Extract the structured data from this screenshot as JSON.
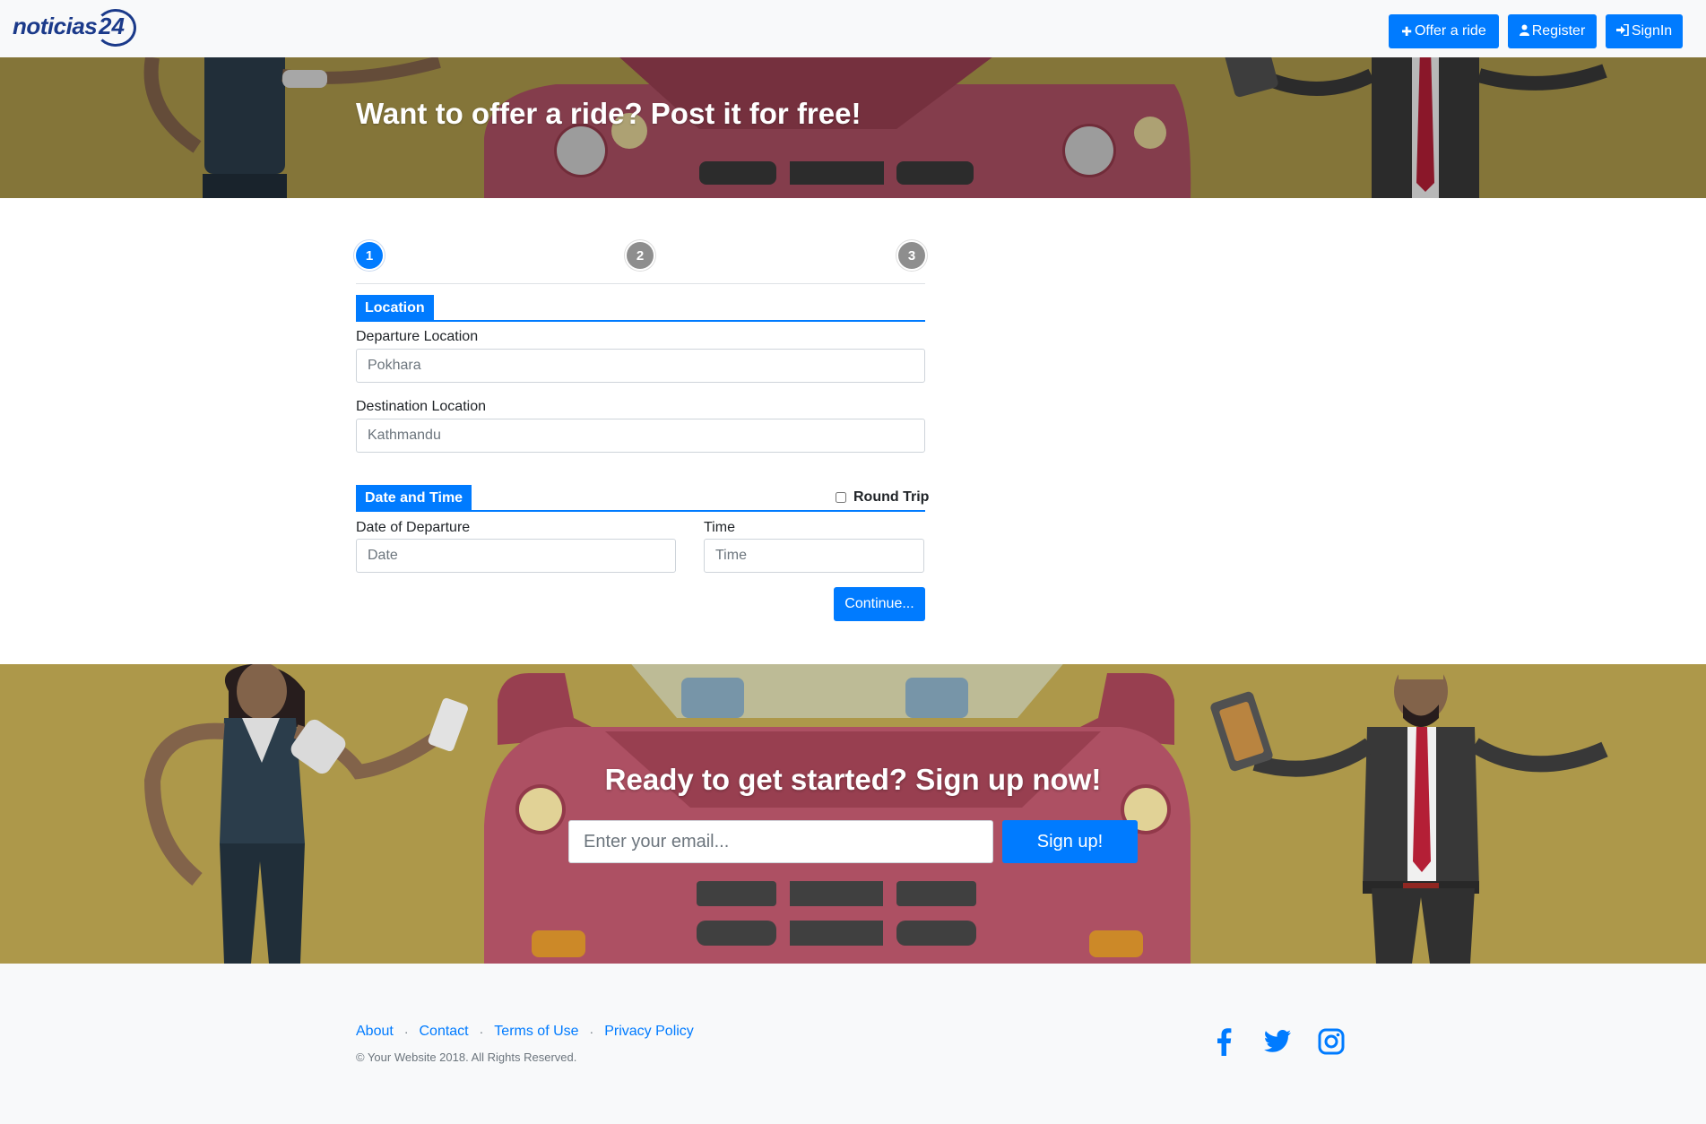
{
  "brand": {
    "logo_text": "noticias",
    "logo_number": "24"
  },
  "nav": {
    "offer_ride": "Offer a ride",
    "register": "Register",
    "signin": "SignIn"
  },
  "hero": {
    "title": "Want to offer a ride? Post it for free!"
  },
  "wizard": {
    "steps": [
      "1",
      "2",
      "3"
    ],
    "active_step": 1,
    "location_section": "Location",
    "departure_label": "Departure Location",
    "departure_placeholder": "Pokhara",
    "destination_label": "Destination Location",
    "destination_placeholder": "Kathmandu",
    "datetime_section": "Date and Time",
    "round_trip_label": "Round Trip",
    "date_label": "Date of Departure",
    "date_placeholder": "Date",
    "time_label": "Time",
    "time_placeholder": "Time",
    "continue_label": "Continue..."
  },
  "cta": {
    "title": "Ready to get started? Sign up now!",
    "email_placeholder": "Enter your email...",
    "signup_label": "Sign up!"
  },
  "footer": {
    "links": [
      "About",
      "Contact",
      "Terms of Use",
      "Privacy Policy"
    ],
    "separator": "·",
    "copyright": "© Your Website 2018. All Rights Reserved.",
    "social_icons": [
      "facebook-icon",
      "twitter-icon",
      "instagram-icon"
    ]
  },
  "colors": {
    "primary": "#007bff",
    "brand": "#1b3a8a",
    "banner": "#b8a24f",
    "car": "#b8556a"
  }
}
